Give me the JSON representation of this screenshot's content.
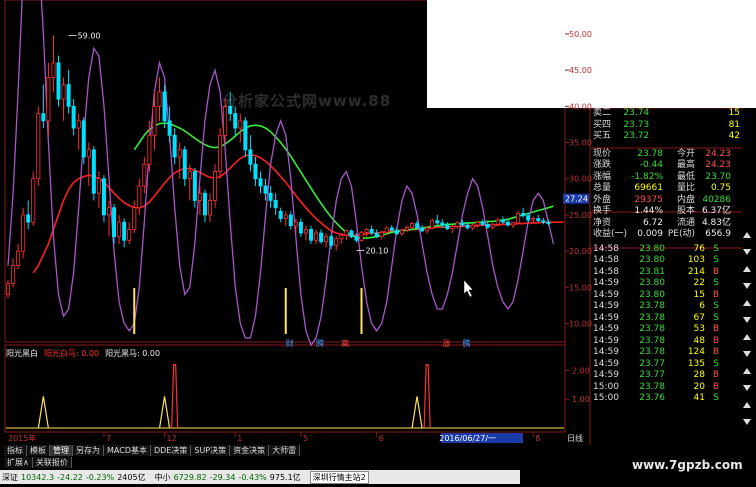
{
  "watermark": "分析家公式网www.88",
  "site_badge": "www.7gpzb.com",
  "chart_data": {
    "type": "candlestick",
    "price_axis": {
      "ticks": [
        50.0,
        45.0,
        40.0,
        35.0,
        30.0,
        25.0,
        20.0,
        15.0,
        10.0
      ],
      "ylim": [
        8,
        54
      ]
    },
    "current_price_label": "27.24",
    "annotations": [
      {
        "text": "59.00",
        "x": 12,
        "price": 49.8,
        "color": "#eeeeee"
      },
      {
        "text": "20.10",
        "x": 69,
        "price": 20.1,
        "color": "#eeeeee"
      }
    ],
    "event_labels": [
      {
        "text": "财",
        "x": 55,
        "color": "#3399ff"
      },
      {
        "text": "腾",
        "x": 61,
        "color": "#3399ff"
      },
      {
        "text": "高",
        "x": 66,
        "color": "#ff4444"
      },
      {
        "text": "涨",
        "x": 86,
        "color": "#ff4444"
      },
      {
        "text": "腾",
        "x": 90,
        "color": "#3399ff"
      }
    ],
    "date_axis": {
      "labels": [
        {
          "text": "2015年",
          "x": 0
        },
        {
          "text": "7",
          "x": 19
        },
        {
          "text": "12",
          "x": 31
        },
        {
          "text": "1",
          "x": 45
        },
        {
          "text": "5",
          "x": 58
        },
        {
          "text": "6",
          "x": 73
        },
        {
          "text": "2016/06/27/一",
          "x": 85
        },
        {
          "text": "8",
          "x": 104
        }
      ],
      "right_label": "日线"
    },
    "candles": [
      [
        14,
        16,
        13.5,
        15.5
      ],
      [
        15.5,
        19,
        15,
        18
      ],
      [
        18,
        21,
        17.5,
        20
      ],
      [
        20,
        26,
        19,
        25
      ],
      [
        25,
        27,
        23,
        24
      ],
      [
        24,
        31,
        23.5,
        30
      ],
      [
        30,
        40,
        29,
        39
      ],
      [
        39,
        43,
        37,
        38
      ],
      [
        38,
        46,
        36,
        44
      ],
      [
        44,
        49.8,
        42,
        46
      ],
      [
        46,
        47,
        40,
        41
      ],
      [
        41,
        44,
        38,
        43
      ],
      [
        43,
        45,
        39,
        40
      ],
      [
        40,
        41,
        36,
        37
      ],
      [
        37,
        39,
        34,
        38
      ],
      [
        38,
        38.5,
        32,
        33
      ],
      [
        33,
        35,
        29,
        34
      ],
      [
        34,
        34.5,
        27,
        28
      ],
      [
        28,
        31,
        26,
        30
      ],
      [
        30,
        30.5,
        24,
        25
      ],
      [
        25,
        27,
        22,
        26
      ],
      [
        26,
        26.5,
        21,
        22
      ],
      [
        22,
        25,
        21,
        24
      ],
      [
        24,
        24.5,
        20.5,
        21.5
      ],
      [
        21.5,
        24,
        21,
        23
      ],
      [
        23,
        27,
        22.5,
        26
      ],
      [
        26,
        30,
        25,
        29
      ],
      [
        29,
        33,
        28,
        32
      ],
      [
        32,
        38,
        31,
        36
      ],
      [
        36,
        42,
        34,
        40
      ],
      [
        40,
        44,
        38,
        42
      ],
      [
        42,
        43,
        37,
        38
      ],
      [
        38,
        40,
        35,
        36
      ],
      [
        36,
        37,
        32,
        33
      ],
      [
        33,
        35,
        30,
        34
      ],
      [
        34,
        34.5,
        29,
        30
      ],
      [
        30,
        32,
        27,
        31
      ],
      [
        31,
        31.5,
        26,
        27
      ],
      [
        27,
        29,
        25,
        28
      ],
      [
        28,
        28.5,
        24,
        25
      ],
      [
        25,
        28,
        24,
        27
      ],
      [
        27,
        32,
        26,
        31
      ],
      [
        31,
        37,
        30,
        36
      ],
      [
        36,
        41,
        35,
        40
      ],
      [
        40,
        42,
        38,
        39
      ],
      [
        39,
        40,
        36,
        37
      ],
      [
        37,
        39,
        35,
        38
      ],
      [
        38,
        38.5,
        33,
        34
      ],
      [
        34,
        36,
        31,
        32
      ],
      [
        32,
        33,
        29,
        30
      ],
      [
        30,
        31,
        28,
        29
      ],
      [
        29,
        30,
        27,
        28
      ],
      [
        28,
        29,
        26,
        27
      ],
      [
        27,
        28,
        25,
        26
      ],
      [
        25.5,
        26,
        24,
        24.5
      ],
      [
        24.5,
        25.5,
        23.5,
        25
      ],
      [
        25,
        25.5,
        23,
        23.5
      ],
      [
        23.5,
        24.5,
        22.5,
        24
      ],
      [
        24,
        24.5,
        22,
        22.5
      ],
      [
        22.5,
        23.5,
        21.5,
        23
      ],
      [
        23,
        23.5,
        21,
        21.5
      ],
      [
        21.5,
        23,
        21,
        22.5
      ],
      [
        22.5,
        23,
        21,
        21.3
      ],
      [
        21.3,
        22.5,
        20.5,
        22
      ],
      [
        22,
        22.3,
        20.3,
        20.8
      ],
      [
        20.8,
        22,
        20.1,
        21.7
      ],
      [
        21.7,
        22.5,
        21,
        22.2
      ],
      [
        22.2,
        23,
        21.5,
        22.8
      ],
      [
        22.8,
        23,
        21.8,
        22
      ],
      [
        22,
        22.5,
        21.2,
        21.5
      ],
      [
        21.5,
        22.8,
        21.3,
        22.6
      ],
      [
        22.6,
        23.2,
        22,
        23
      ],
      [
        23,
        23.5,
        22.2,
        22.5
      ],
      [
        22.5,
        23,
        21.8,
        22
      ],
      [
        22,
        22.8,
        21.6,
        22.6
      ],
      [
        22.6,
        23.4,
        22.3,
        23.2
      ],
      [
        23.2,
        23.6,
        22.6,
        22.9
      ],
      [
        22.9,
        23.3,
        22.2,
        22.4
      ],
      [
        22.4,
        23.1,
        22.1,
        22.9
      ],
      [
        22.9,
        23.5,
        22.6,
        23.3
      ],
      [
        23.3,
        24,
        23,
        23.8
      ],
      [
        23.8,
        24.2,
        23,
        23.2
      ],
      [
        23.2,
        23.6,
        22.6,
        22.8
      ],
      [
        22.8,
        23.4,
        22.4,
        23.2
      ],
      [
        23.2,
        24.5,
        23,
        24.2
      ],
      [
        24.2,
        25,
        23.6,
        23.9
      ],
      [
        23.9,
        24.4,
        23.2,
        23.6
      ],
      [
        23.6,
        24,
        22.9,
        23.1
      ],
      [
        23.1,
        23.6,
        22.5,
        23.4
      ],
      [
        23.4,
        24.1,
        23.1,
        23.9
      ],
      [
        23.9,
        24.3,
        23.4,
        23.6
      ],
      [
        23.6,
        24,
        23,
        23.2
      ],
      [
        23.2,
        23.8,
        22.9,
        23.6
      ],
      [
        23.6,
        24.2,
        23.3,
        24
      ],
      [
        24,
        24.4,
        23.5,
        23.7
      ],
      [
        23.7,
        24,
        23.1,
        23.3
      ],
      [
        23.3,
        23.9,
        23,
        23.7
      ],
      [
        23.7,
        24.6,
        23.5,
        24.3
      ],
      [
        24.3,
        24.8,
        23.8,
        24
      ],
      [
        24,
        24.5,
        23.4,
        23.6
      ],
      [
        23.6,
        24.1,
        23.2,
        23.9
      ],
      [
        23.9,
        25.5,
        23.7,
        25.2
      ],
      [
        25.2,
        26,
        24.6,
        24.9
      ],
      [
        24.9,
        25.3,
        24,
        24.3
      ],
      [
        24.3,
        24.8,
        23.8,
        24.5
      ],
      [
        24.5,
        25,
        24,
        24.2
      ],
      [
        24.2,
        24.6,
        23.7,
        24
      ],
      [
        24,
        24.4,
        23.5,
        23.8
      ]
    ],
    "series": [
      {
        "name": "",
        "color": "#ff2020",
        "values": [
          null,
          null,
          null,
          null,
          null,
          17,
          18,
          19.5,
          21,
          23,
          25,
          27,
          28.5,
          29.5,
          30,
          30.3,
          30.5,
          30.3,
          30,
          29.5,
          28.8,
          28,
          27.3,
          26.7,
          26.3,
          26,
          26,
          26.2,
          26.8,
          27.6,
          28.5,
          29.4,
          30.2,
          30.8,
          31.2,
          31.4,
          31.4,
          31.2,
          30.9,
          30.5,
          30.2,
          30.1,
          30.3,
          30.8,
          31.5,
          32.2,
          32.8,
          33.2,
          33.3,
          33.2,
          32.9,
          32.4,
          31.8,
          31.1,
          30.3,
          29.5,
          28.6,
          27.7,
          26.8,
          26,
          25.2,
          24.5,
          23.9,
          23.3,
          22.8,
          22.5,
          22.3,
          22.2,
          22.2,
          22.2,
          22.3,
          22.4,
          22.5,
          22.5,
          22.6,
          22.7,
          22.8,
          22.8,
          22.9,
          22.9,
          23,
          23,
          23.1,
          23.1,
          23.2,
          23.3,
          23.3,
          23.3,
          23.4,
          23.4,
          23.4,
          23.5,
          23.5,
          23.5,
          23.6,
          23.6,
          23.6,
          23.6,
          23.7,
          23.7,
          23.7,
          23.8,
          23.8,
          23.9,
          23.9,
          23.9,
          24,
          24,
          24,
          24,
          24
        ]
      },
      {
        "name": "",
        "color": "#33ee33",
        "values": [
          null,
          null,
          null,
          null,
          null,
          null,
          null,
          null,
          null,
          null,
          null,
          null,
          null,
          null,
          null,
          null,
          null,
          null,
          null,
          null,
          null,
          null,
          null,
          null,
          null,
          34,
          35,
          36,
          36.8,
          37.3,
          37.6,
          37.7,
          37.6,
          37.3,
          37,
          36.6,
          36.1,
          35.6,
          35.1,
          34.7,
          34.4,
          34.3,
          34.4,
          34.8,
          35.3,
          35.9,
          36.5,
          37,
          37.3,
          37.4,
          37.3,
          37,
          36.5,
          35.8,
          35,
          34.1,
          33.1,
          32,
          30.9,
          29.8,
          28.7,
          27.6,
          26.6,
          25.6,
          24.7,
          23.9,
          23.2,
          22.6,
          22.2,
          21.9,
          21.8,
          21.8,
          21.9,
          22,
          22.2,
          22.4,
          22.6,
          22.7,
          22.8,
          22.9,
          23,
          23.1,
          23.2,
          23.3,
          23.4,
          23.5,
          23.6,
          23.7,
          23.7,
          23.8,
          23.8,
          23.9,
          23.9,
          24,
          24,
          24.1,
          24.1,
          24.2,
          24.3,
          24.4,
          24.6,
          24.8,
          25,
          25.2,
          25.4,
          25.6,
          25.8,
          26,
          26.2
        ]
      },
      {
        "name": "",
        "color": "#aa55cc",
        "values": [
          18,
          28,
          42,
          58,
          66,
          68,
          62,
          50,
          35,
          22,
          14,
          11,
          12,
          17,
          26,
          36,
          44,
          48,
          47,
          40,
          30,
          20,
          13,
          10,
          9,
          10,
          15,
          24,
          34,
          42,
          46,
          44,
          36,
          26,
          18,
          14,
          15,
          21,
          30,
          38,
          43,
          45,
          42,
          34,
          24,
          15,
          10,
          8,
          8,
          11,
          17,
          25,
          32,
          36,
          38,
          36,
          30,
          22,
          14,
          9,
          7,
          8,
          11,
          16,
          22,
          27,
          30,
          31,
          29,
          24,
          18,
          13,
          10,
          9,
          10,
          13,
          18,
          23,
          27,
          29,
          28,
          25,
          21,
          17,
          14,
          12,
          12,
          14,
          17,
          21,
          25,
          28,
          30,
          29,
          26,
          22,
          18,
          15,
          13,
          12,
          13,
          16,
          20,
          24,
          27,
          28,
          27,
          24,
          21
        ]
      }
    ],
    "indicator": {
      "legend": [
        {
          "text": "阳光黑白",
          "color": "#eeeeee"
        },
        {
          "text": "阳光白马: 0.00",
          "color": "#ff3030"
        },
        {
          "text": "阳光黑马: 0.00",
          "color": "#eeeeee"
        }
      ],
      "ticks": [
        2.0,
        1.0
      ],
      "ylim": [
        0,
        2.5
      ],
      "yellow_spikes": [
        7,
        31,
        81
      ],
      "red_spikes": [
        33,
        83
      ]
    }
  },
  "tabs": [
    "指标",
    "模板",
    "管理",
    "另存为",
    "MACD基本",
    "DDE决策",
    "SUP决策",
    "资金决策",
    "大师雷"
  ],
  "tabs_row2": [
    "扩展∧",
    "关联报价"
  ],
  "statusbar": {
    "index_name": "深证",
    "index_value": "10342.3",
    "index_change": "-24.22",
    "index_pct": "-0.23%",
    "index_vol": "2405亿",
    "small_name": "中小",
    "small_value": "6729.82",
    "small_change": "-29.34",
    "small_pct": "-0.43%",
    "small_vol": "975.1亿",
    "message": "深圳行情主站2"
  },
  "order_book": [
    {
      "label": "卖二",
      "price": "23.74",
      "vol": "15"
    },
    {
      "label": "买四",
      "price": "23.73",
      "vol": "81"
    },
    {
      "label": "买五",
      "price": "23.72",
      "vol": "42"
    }
  ],
  "stats": [
    {
      "l1": "现价",
      "v1": "23.78",
      "c1": "green",
      "l2": "今开",
      "v2": "24.23",
      "c2": "red"
    },
    {
      "l1": "涨跌",
      "v1": "-0.44",
      "c1": "green",
      "l2": "最高",
      "v2": "24.23",
      "c2": "red"
    },
    {
      "l1": "涨幅",
      "v1": "-1.82%",
      "c1": "green",
      "l2": "最低",
      "v2": "23.70",
      "c2": "green"
    },
    {
      "l1": "总量",
      "v1": "69661",
      "c1": "yellow",
      "l2": "量比",
      "v2": "0.75",
      "c2": "yellow"
    },
    {
      "l1": "外盘",
      "v1": "29375",
      "c1": "red",
      "l2": "内盘",
      "v2": "40286",
      "c2": "green"
    },
    {
      "l1": "换手",
      "v1": "1.44%",
      "c1": "white",
      "l2": "股本",
      "v2": "6.37亿",
      "c2": "white"
    },
    {
      "l1": "净资",
      "v1": "6.72",
      "c1": "white",
      "l2": "流通",
      "v2": "4.83亿",
      "c2": "white"
    },
    {
      "l1": "收益(一)",
      "v1": "0.009",
      "c1": "white",
      "l2": "PE(动)",
      "v2": "656.9",
      "c2": "white"
    }
  ],
  "ticks": [
    {
      "time": "14:58",
      "price": "23.80",
      "vol": "76",
      "bs": "S"
    },
    {
      "time": "14:58",
      "price": "23.80",
      "vol": "103",
      "bs": "S"
    },
    {
      "time": "14:58",
      "price": "23.81",
      "vol": "214",
      "bs": "B"
    },
    {
      "time": "14:59",
      "price": "23.80",
      "vol": "22",
      "bs": "S"
    },
    {
      "time": "14:59",
      "price": "23.80",
      "vol": "15",
      "bs": "B"
    },
    {
      "time": "14:59",
      "price": "23.78",
      "vol": "6",
      "bs": "S"
    },
    {
      "time": "14:59",
      "price": "23.78",
      "vol": "67",
      "bs": "S"
    },
    {
      "time": "14:59",
      "price": "23.78",
      "vol": "53",
      "bs": "B"
    },
    {
      "time": "14:59",
      "price": "23.78",
      "vol": "48",
      "bs": "B"
    },
    {
      "time": "14:59",
      "price": "23.78",
      "vol": "124",
      "bs": "B"
    },
    {
      "time": "14:59",
      "price": "23.77",
      "vol": "135",
      "bs": "S"
    },
    {
      "time": "14:59",
      "price": "23.77",
      "vol": "28",
      "bs": "B"
    },
    {
      "time": "15:00",
      "price": "23.78",
      "vol": "20",
      "bs": "B"
    },
    {
      "time": "15:00",
      "price": "23.76",
      "vol": "41",
      "bs": "S"
    }
  ],
  "scroll_icons": [
    "arrow-up-icon",
    "arrow-down-icon",
    "arrow-up-icon",
    "arrow-down-icon",
    "arrow-up-icon",
    "arrow-down-icon",
    "arrow-up-icon",
    "arrow-down-icon",
    "arrow-up-icon",
    "arrow-down-icon",
    "arrow-up-icon",
    "arrow-down-icon"
  ]
}
